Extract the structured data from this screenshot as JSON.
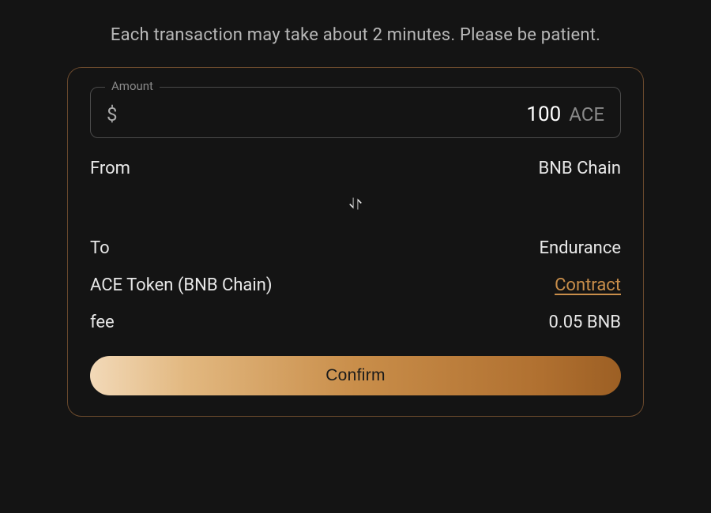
{
  "notice": "Each transaction may take about 2 minutes. Please be patient.",
  "amount": {
    "legend": "Amount",
    "currency_symbol": "$",
    "value": "100",
    "unit": "ACE"
  },
  "from": {
    "label": "From",
    "value": "BNB Chain"
  },
  "to": {
    "label": "To",
    "value": "Endurance"
  },
  "token": {
    "label": "ACE Token (BNB Chain)",
    "contract_link": "Contract"
  },
  "fee": {
    "label": "fee",
    "value": "0.05 BNB"
  },
  "confirm_label": "Confirm"
}
